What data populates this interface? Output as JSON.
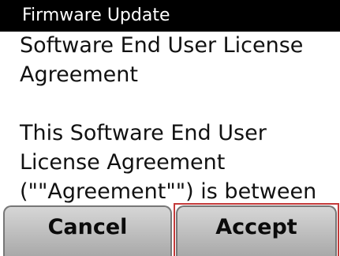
{
  "window": {
    "title": "Firmware Update"
  },
  "content": {
    "lines": [
      "Software End User License",
      "Agreement",
      "",
      "This Software End User",
      "License Agreement",
      "(\"\"Agreement\"\") is between"
    ]
  },
  "buttons": {
    "cancel_label": "Cancel",
    "accept_label": "Accept"
  },
  "colors": {
    "title_bar_bg": "#000000",
    "title_text": "#ffffff",
    "button_bg_top": "#d6d6d6",
    "button_bg_bottom": "#a9a9a9",
    "focus_outline": "#c43a3a"
  }
}
